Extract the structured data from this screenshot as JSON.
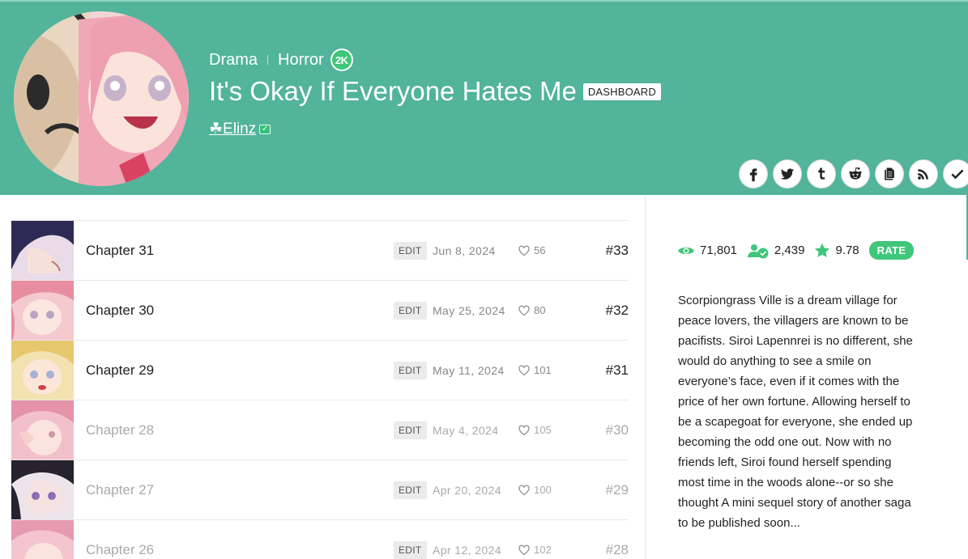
{
  "colors": {
    "header_bg": "#52b49a",
    "accent": "#3fc67a"
  },
  "series": {
    "genres": [
      "Drama",
      "Horror"
    ],
    "badge": "2K",
    "title": "It's Okay If Everyone Hates Me",
    "dashboard_label": "DASHBOARD",
    "author": "☘Elinz",
    "author_verified_icon": "verified-check-icon"
  },
  "share_icons": [
    "facebook-icon",
    "twitter-icon",
    "tumblr-icon",
    "reddit-icon",
    "copy-icon",
    "rss-icon",
    "subscribe-check-icon"
  ],
  "chapters": [
    {
      "title": "Chapter 31",
      "edit": "EDIT",
      "date": "Jun 8, 2024",
      "likes": "56",
      "num": "#33",
      "dim": false
    },
    {
      "title": "Chapter 30",
      "edit": "EDIT",
      "date": "May 25, 2024",
      "likes": "80",
      "num": "#32",
      "dim": false
    },
    {
      "title": "Chapter 29",
      "edit": "EDIT",
      "date": "May 11, 2024",
      "likes": "101",
      "num": "#31",
      "dim": false
    },
    {
      "title": "Chapter 28",
      "edit": "EDIT",
      "date": "May 4, 2024",
      "likes": "105",
      "num": "#30",
      "dim": true
    },
    {
      "title": "Chapter 27",
      "edit": "EDIT",
      "date": "Apr 20, 2024",
      "likes": "100",
      "num": "#29",
      "dim": true
    },
    {
      "title": "Chapter 26",
      "edit": "EDIT",
      "date": "Apr 12, 2024",
      "likes": "102",
      "num": "#28",
      "dim": true
    }
  ],
  "stats": {
    "views": "71,801",
    "subscribers": "2,439",
    "rating": "9.78",
    "rate_label": "RATE"
  },
  "description": "Scorpiongrass Ville is a dream village for peace lovers, the villagers are known to be pacifists. Siroi Lapennrei is no different, she would do anything to see a smile on everyone’s face, even if it comes with the price of her own fortune. Allowing herself to be a scapegoat for everyone, she ended up becoming the odd one out. Now with no friends left, Siroi found herself spending most time in the woods alone--or so she thought A mini sequel story of another saga to be published soon..."
}
